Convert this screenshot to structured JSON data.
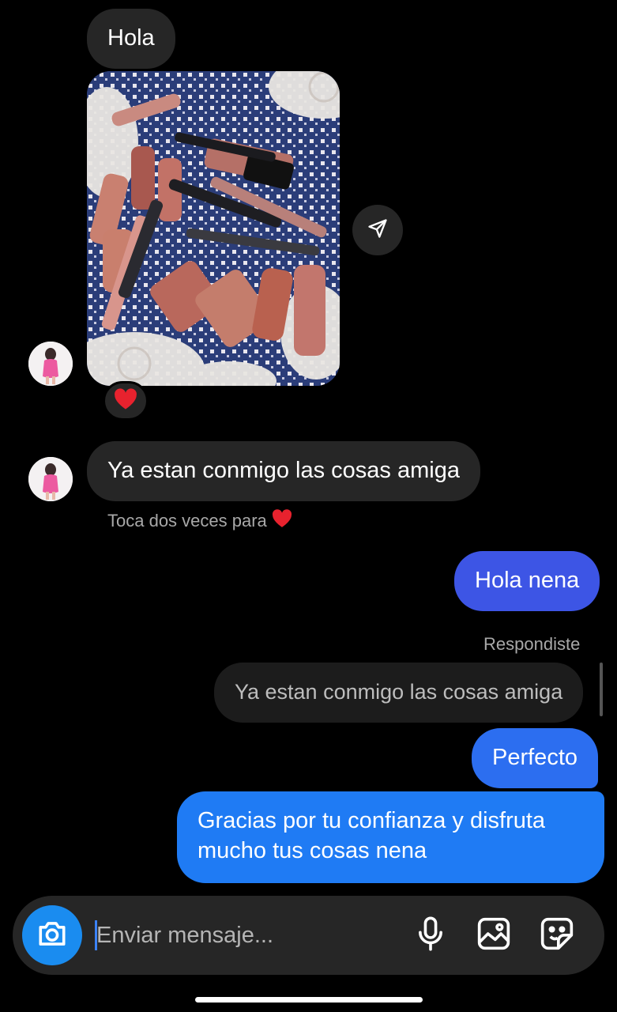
{
  "thread": {
    "messages": [
      {
        "id": "m1",
        "text": "Hola"
      },
      {
        "id": "m3",
        "text": "Ya estan conmigo las cosas amiga"
      },
      {
        "id": "m4",
        "text": "Hola nena"
      },
      {
        "id": "m5",
        "text": "Perfecto"
      },
      {
        "id": "m6",
        "text": "Gracias por tu confianza y disfruta mucho tus cosas nena"
      }
    ],
    "double_tap_hint": "Toca dos veces para",
    "replied_label": "Respondiste",
    "reply_preview_text": "Ya estan conmigo las cosas amiga",
    "reaction_icon": "heart-icon"
  },
  "composer": {
    "placeholder": "Enviar mensaje...",
    "camera_icon": "camera-icon",
    "mic_icon": "microphone-icon",
    "gallery_icon": "image-icon",
    "sticker_icon": "sticker-icon"
  },
  "colors": {
    "background": "#000000",
    "incoming_bubble": "#262626",
    "outgoing_bubble": "#3b5ee8",
    "camera_button": "#1a8cf0",
    "heart": "#e8222e"
  }
}
